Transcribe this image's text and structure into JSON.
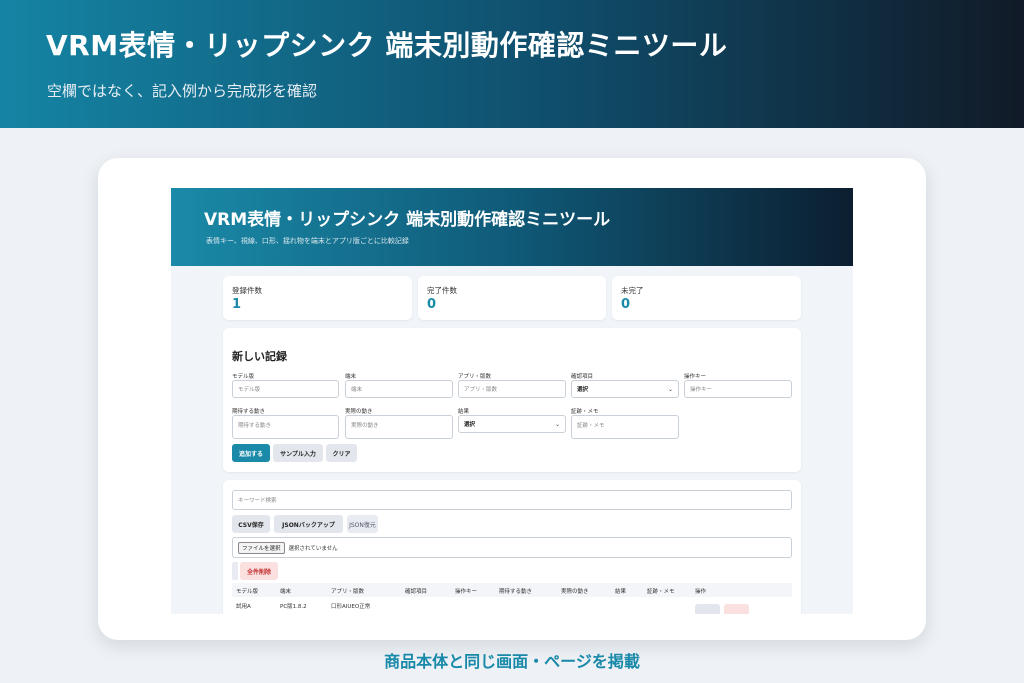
{
  "hero": {
    "title": "VRM表情・リップシンク 端末別動作確認ミニツール",
    "subtitle": "空欄ではなく、記入例から完成形を確認"
  },
  "app": {
    "title": "VRM表情・リップシンク 端末別動作確認ミニツール",
    "subtitle": "表情キー、視線、口形、揺れ物を端末とアプリ版ごとに比較記録"
  },
  "stats": [
    {
      "label": "登録件数",
      "value": "1"
    },
    {
      "label": "完了件数",
      "value": "0"
    },
    {
      "label": "未完了",
      "value": "0"
    }
  ],
  "form": {
    "heading": "新しい記録",
    "fields": {
      "model": {
        "label": "モデル版",
        "placeholder": "モデル版"
      },
      "device": {
        "label": "端末",
        "placeholder": "端末"
      },
      "app_version": {
        "label": "アプリ・版数",
        "placeholder": "アプリ・版数"
      },
      "check_item": {
        "label": "確認項目",
        "value": "選択"
      },
      "key": {
        "label": "操作キー",
        "placeholder": "操作キー"
      },
      "expected": {
        "label": "期待する動き",
        "placeholder": "期待する動き"
      },
      "actual": {
        "label": "実際の動き",
        "placeholder": "実際の動き"
      },
      "result": {
        "label": "結果",
        "value": "選択"
      },
      "evidence": {
        "label": "証跡・メモ",
        "placeholder": "証跡・メモ"
      }
    },
    "buttons": {
      "add": "追加する",
      "sample": "サンプル入力",
      "clear": "クリア"
    }
  },
  "list": {
    "search_placeholder": "キーワード検索",
    "buttons": {
      "csv": "CSV保存",
      "json_backup": "JSONバックアップ",
      "json_restore": "JSON復元",
      "file_choose": "ファイルを選択",
      "delete_all": "全件削除"
    },
    "file_status": "選択されていません",
    "columns": [
      "モデル版",
      "端末",
      "アプリ・版数",
      "確認項目",
      "操作キー",
      "期待する動き",
      "実際の動き",
      "結果",
      "証跡・メモ",
      "操作"
    ],
    "rows": [
      {
        "model": "試用A",
        "device": "PC版1.8.2",
        "app_version": "口形AIUEO正常"
      }
    ]
  },
  "caption": "商品本体と同じ画面・ページを掲載",
  "colors": {
    "accent": "#1a8aa8",
    "hero_dark": "#111a27",
    "danger": "#c23030"
  }
}
